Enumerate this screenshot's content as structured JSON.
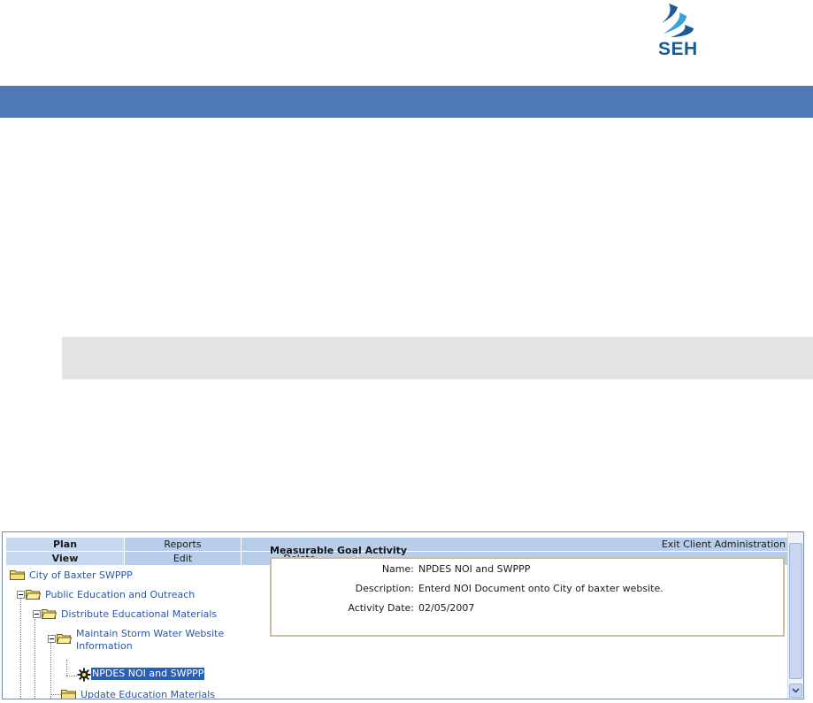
{
  "header": {
    "logo_text": "SEH",
    "colors": {
      "banner": "#4f7ab8",
      "logo_primary": "#1c5c96",
      "logo_accent": "#3aa0d8"
    }
  },
  "tabs": {
    "row1": [
      "Plan",
      "Reports",
      "Exit Client Administration"
    ],
    "row2": [
      "View",
      "Edit",
      "Delete"
    ]
  },
  "tree": [
    {
      "label": "City of Baxter SWPPP",
      "icon": "folder-icon"
    },
    {
      "label": "Public Education and Outreach",
      "icon": "folder-icon"
    },
    {
      "label": "Distribute Educational Materials",
      "icon": "folder-icon"
    },
    {
      "label_line1": "Maintain Storm Water Website",
      "label_line2": "Information",
      "icon": "folder-icon"
    },
    {
      "label": "NPDES NOI and SWPPP",
      "icon": "gear-icon",
      "selected": true
    },
    {
      "label": "Update Education Materials",
      "icon": "folder-icon"
    }
  ],
  "detail": {
    "title": "Measurable Goal Activity",
    "fields": [
      {
        "label": "Name:",
        "value": "NPDES NOI and SWPPP"
      },
      {
        "label": "Description:",
        "value": "Enterd NOI Document onto City of baxter website."
      },
      {
        "label": "Activity Date:",
        "value": "02/05/2007"
      }
    ]
  }
}
